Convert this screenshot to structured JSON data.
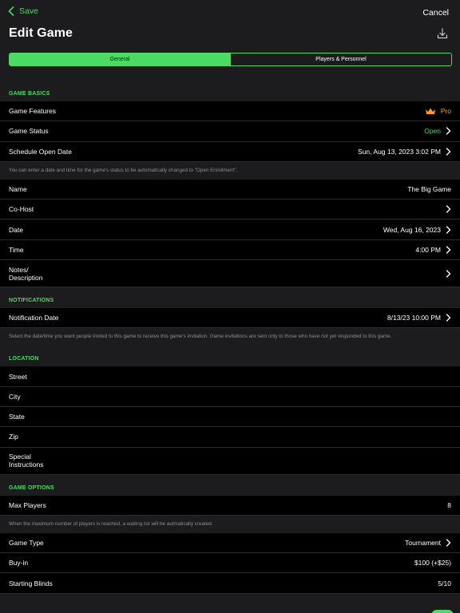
{
  "nav": {
    "save_label": "Save",
    "cancel_label": "Cancel",
    "title": "Edit Game"
  },
  "tabs": {
    "general": "General",
    "players": "Players & Personnel"
  },
  "game_basics": {
    "header": "GAME BASICS",
    "features_label": "Game Features",
    "features_value": "Pro",
    "status_label": "Game Status",
    "status_value": "Open",
    "schedule_label": "Schedule Open Date",
    "schedule_value": "Sun, Aug 13, 2023 3:02 PM",
    "schedule_note": "You can enter a date and time for the game's status to be automatically changed to \"Open Enrollment\".",
    "name_label": "Name",
    "name_value": "The Big Game",
    "cohost_label": "Co-Host",
    "date_label": "Date",
    "date_value": "Wed, Aug 16, 2023",
    "time_label": "Time",
    "time_value": "4:00 PM",
    "notes_label_1": "Notes/",
    "notes_label_2": "Description"
  },
  "notifications": {
    "header": "NOTIFICATIONS",
    "date_label": "Notification Date",
    "date_value": "8/13/23 10:00 PM",
    "note": "Select the date/time you want people invited to this game to receive this game's invitation.  Game invitations are sent only to those who have not yet responded to this game."
  },
  "location": {
    "header": "LOCATION",
    "street_label": "Street",
    "city_label": "City",
    "state_label": "State",
    "zip_label": "Zip",
    "special_label_1": "Special",
    "special_label_2": "Instructions"
  },
  "game_options": {
    "header": "GAME OPTIONS",
    "max_players_label": "Max Players",
    "max_players_value": "8",
    "max_players_note": "When the maximum number of players is reached, a waiting list will be autmatically created.",
    "game_type_label": "Game Type",
    "game_type_value": "Tournament",
    "buyin_label": "Buy-in",
    "buyin_value": "$100 (+$25)",
    "blinds_label": "Starting Blinds",
    "blinds_value": "5/10"
  },
  "colors": {
    "accent": "#4cd964",
    "pro": "#ff9f0a",
    "background": "#1c1c1e",
    "row": "#000000"
  },
  "icons": [
    "chevron-left-icon",
    "export-icon",
    "crown-icon",
    "chevron-right-icon"
  ]
}
